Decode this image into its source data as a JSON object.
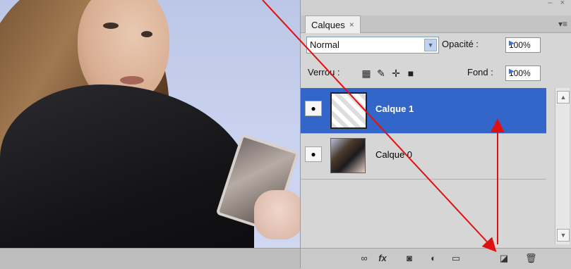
{
  "panel": {
    "tab_label": "Calques",
    "tab_close_icon": "×",
    "blend_mode": "Normal",
    "opacity_label": "Opacité :",
    "opacity_value": "100%",
    "lock_label": "Verrou :",
    "fill_label": "Fond :",
    "fill_value": "100%",
    "window_buttons": "– ×"
  },
  "layers": [
    {
      "name": "Calque 1",
      "selected": true,
      "visible": true
    },
    {
      "name": "Calque 0",
      "selected": false,
      "visible": true
    }
  ],
  "icons": {
    "eye": "eye-icon",
    "link": "link-layers-icon",
    "fx": "fx-icon",
    "mask": "add-mask-icon",
    "adjust": "adjustment-layer-icon",
    "group": "folder-icon",
    "new": "new-layer-icon",
    "trash": "trash-icon"
  },
  "colors": {
    "selection": "#3267c9",
    "annotation": "#e01010"
  },
  "bottom_bar": {
    "fx_label": "fx"
  }
}
